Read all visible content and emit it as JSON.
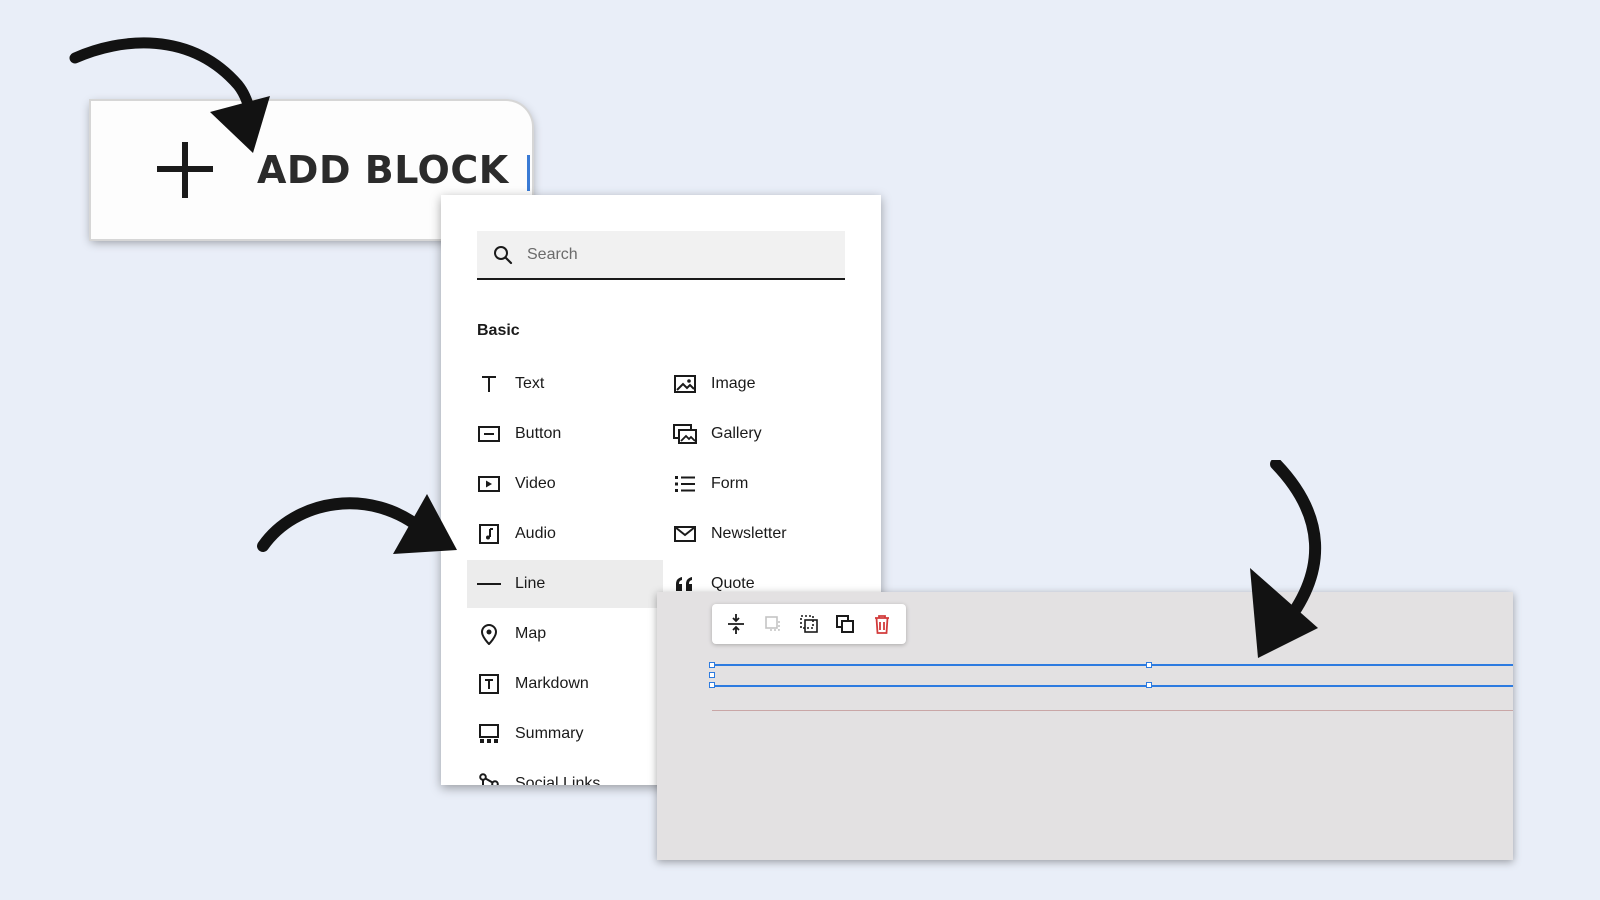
{
  "add_block": {
    "label": "ADD BLOCK"
  },
  "block_menu": {
    "search_placeholder": "Search",
    "section_title": "Basic",
    "left_items": [
      {
        "label": "Text",
        "icon": "text-icon"
      },
      {
        "label": "Button",
        "icon": "button-icon"
      },
      {
        "label": "Video",
        "icon": "video-icon"
      },
      {
        "label": "Audio",
        "icon": "audio-icon"
      },
      {
        "label": "Line",
        "icon": "line-icon",
        "selected": true
      },
      {
        "label": "Map",
        "icon": "map-pin-icon"
      },
      {
        "label": "Markdown",
        "icon": "markdown-icon"
      },
      {
        "label": "Summary",
        "icon": "summary-icon"
      },
      {
        "label": "Social Links",
        "icon": "social-links-icon"
      }
    ],
    "right_items": [
      {
        "label": "Image",
        "icon": "image-icon"
      },
      {
        "label": "Gallery",
        "icon": "gallery-icon"
      },
      {
        "label": "Form",
        "icon": "form-icon"
      },
      {
        "label": "Newsletter",
        "icon": "newsletter-icon"
      },
      {
        "label": "Quote",
        "icon": "quote-icon"
      }
    ]
  },
  "editor_toolbar": {
    "tools": [
      "spacing-icon",
      "unstack-icon",
      "select-icon",
      "duplicate-icon",
      "delete-icon"
    ],
    "delete_color": "#d23b3b"
  },
  "colors": {
    "background": "#e9eef8",
    "selection": "#2d7be0",
    "accent": "#3a7bd5"
  }
}
